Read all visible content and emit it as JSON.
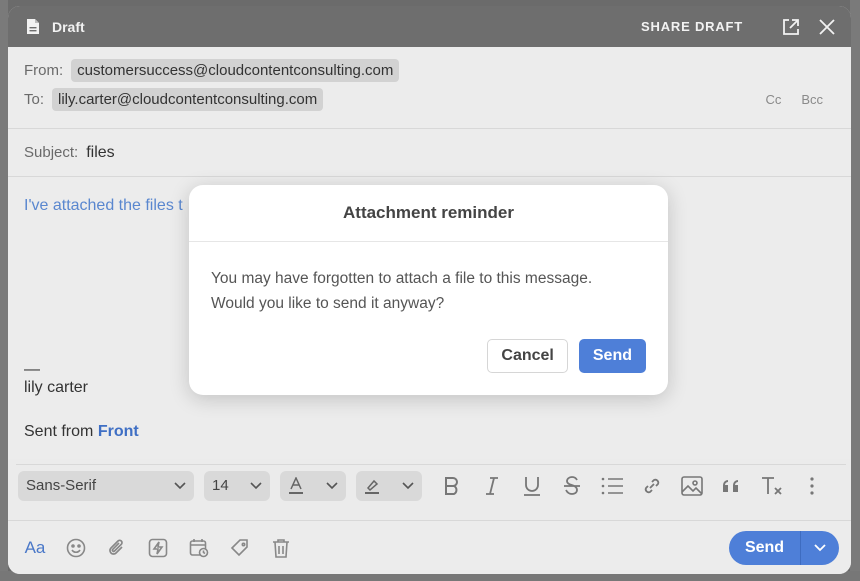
{
  "window": {
    "title": "Draft",
    "share_label": "SHARE DRAFT"
  },
  "header": {
    "from_label": "From:",
    "from_value": "customersuccess@cloudcontentconsulting.com",
    "to_label": "To:",
    "to_value": "lily.carter@cloudcontentconsulting.com",
    "cc_label": "Cc",
    "bcc_label": "Bcc"
  },
  "subject": {
    "label": "Subject:",
    "value": "files"
  },
  "body": {
    "text_visible": "I've attached the files t",
    "signature_dash": "—",
    "signature_name": "lily carter",
    "sent_from_prefix": "Sent from ",
    "sent_from_link": "Front"
  },
  "format_bar": {
    "font_family": "Sans-Serif",
    "font_size": "14"
  },
  "action_bar": {
    "aa_label": "Aa",
    "send_label": "Send"
  },
  "modal": {
    "title": "Attachment reminder",
    "line1": "You may have forgotten to attach a file to this message.",
    "line2": "Would you like to send it anyway?",
    "cancel_label": "Cancel",
    "send_label": "Send"
  },
  "colors": {
    "accent": "#4e7fd8",
    "link": "#3f6fc4",
    "titlebar": "#6e6e6e"
  }
}
